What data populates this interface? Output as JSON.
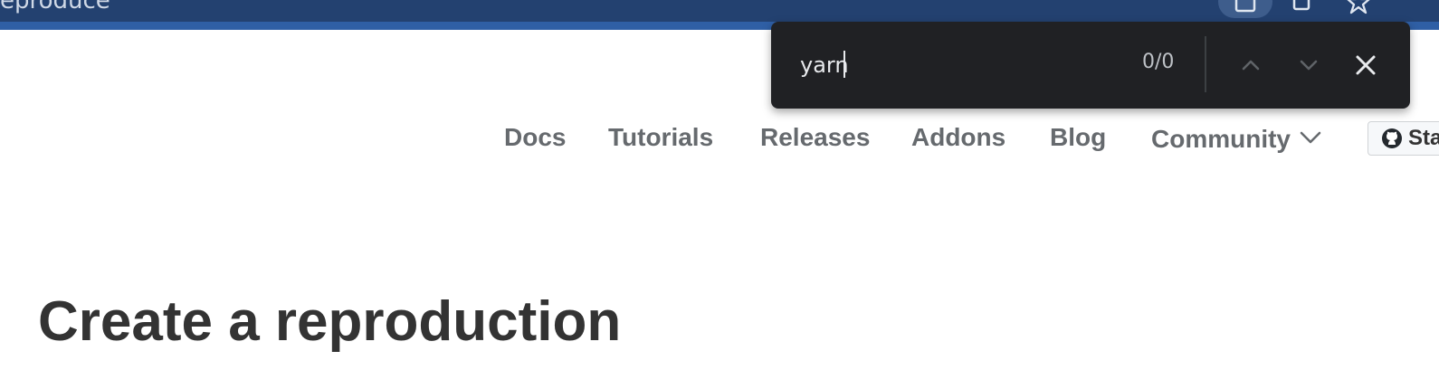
{
  "browser": {
    "tab_title_fragment": "eproduce",
    "icons": [
      "reading-mode-icon",
      "extension-icon",
      "bookmark-star-icon"
    ]
  },
  "find_bar": {
    "query": "yarn",
    "match_count": "0/0",
    "icons": [
      "previous-match-icon",
      "next-match-icon",
      "close-icon"
    ]
  },
  "nav": {
    "items": [
      {
        "label": "Docs"
      },
      {
        "label": "Tutorials"
      },
      {
        "label": "Releases"
      },
      {
        "label": "Addons"
      },
      {
        "label": "Blog"
      },
      {
        "label": "Community"
      }
    ],
    "github_button_label": "Sta"
  },
  "main": {
    "title": "Create a reproduction"
  },
  "colors": {
    "chrome_bg": "#234170",
    "findbar_bg": "#202124",
    "nav_text": "#666a6e",
    "title_text": "#333333"
  }
}
